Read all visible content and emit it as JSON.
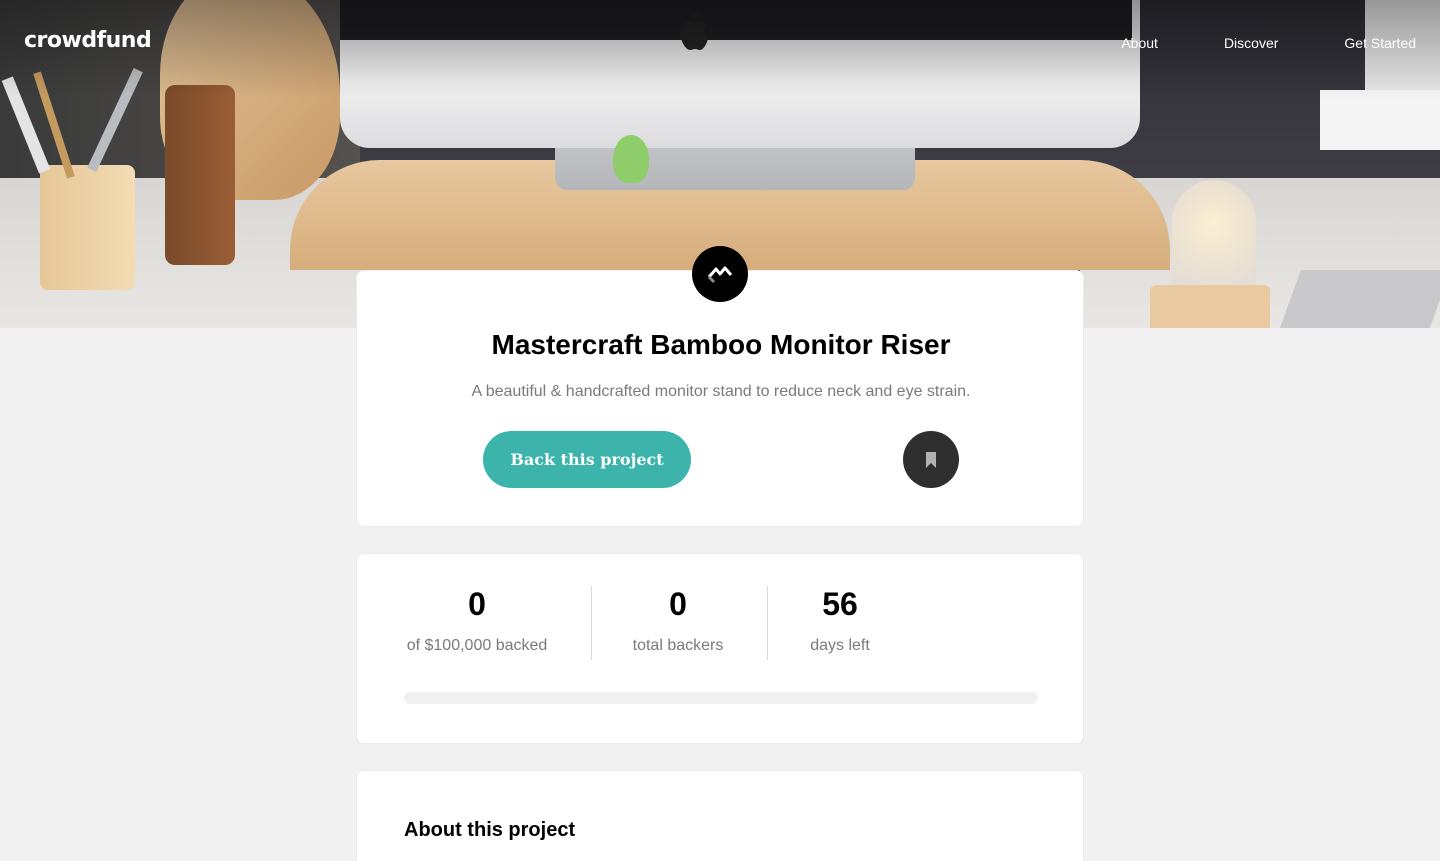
{
  "brand": {
    "logo_text": "crowdfund"
  },
  "nav": {
    "items": [
      "About",
      "Discover",
      "Get Started"
    ]
  },
  "project": {
    "logo_icon": "mastercraft-logo-icon",
    "title": "Mastercraft Bamboo Monitor Riser",
    "subtitle": "A beautiful & handcrafted monitor stand to reduce neck and eye strain.",
    "back_button_label": "Back this project",
    "bookmark_icon": "bookmark-icon"
  },
  "stats": {
    "backed": {
      "value": "0",
      "label": "of $100,000 backed"
    },
    "backers": {
      "value": "0",
      "label": "total backers"
    },
    "days": {
      "value": "56",
      "label": "days left"
    },
    "progress_fraction": 0
  },
  "about": {
    "title": "About this project"
  },
  "colors": {
    "accent": "#3cb3ab",
    "dark": "#2f2f2f",
    "muted_text": "#7a7a7a",
    "background": "#f1f1f1"
  }
}
